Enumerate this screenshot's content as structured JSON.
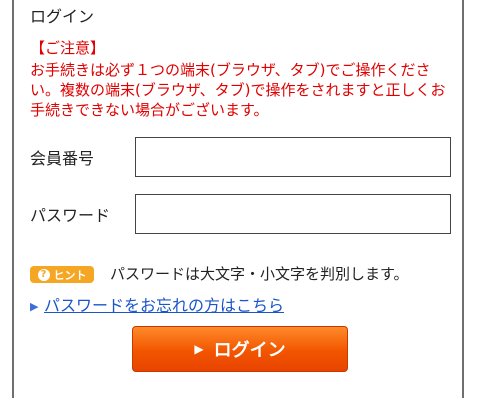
{
  "title": "ログイン",
  "notice": {
    "heading": "【ご注意】",
    "body": "お手続きは必ず１つの端末(ブラウザ、タブ)でご操作ください。複数の端末(ブラウザ、タブ)で操作をされますと正しくお手続きできない場合がございます。",
    "color": "#e00000"
  },
  "form": {
    "member_label": "会員番号",
    "member_value": "",
    "password_label": "パスワード",
    "password_value": ""
  },
  "hint": {
    "badge_label": "ヒント",
    "badge_color": "#f5a623",
    "text": "パスワードは大文字・小文字を判別します。"
  },
  "forgot_link": "パスワードをお忘れの方はこちら",
  "login_button": {
    "label": "ログイン",
    "color": "#f25500"
  }
}
